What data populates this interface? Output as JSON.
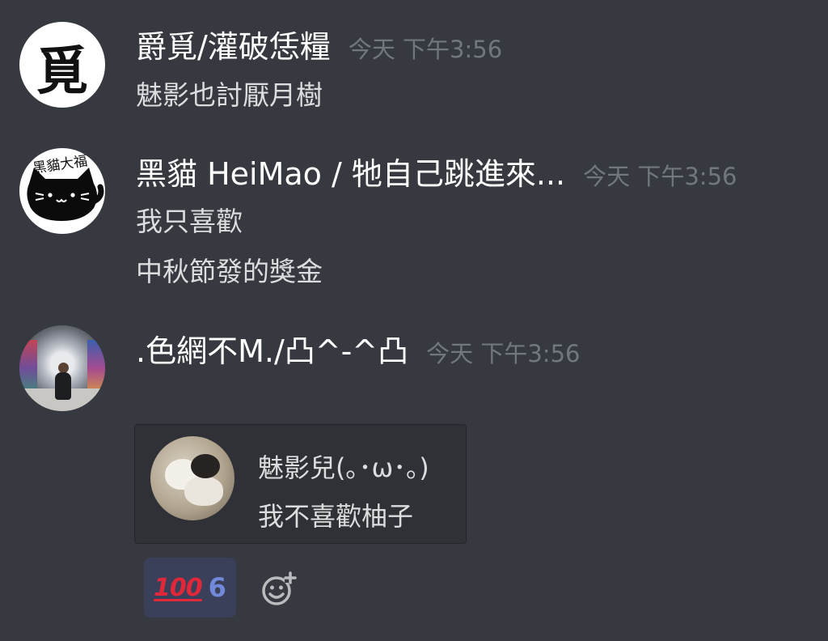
{
  "messages": [
    {
      "username": "爵覓/灌破恁糧",
      "timestamp": "今天 下午3:56",
      "avatar_glyph": "覓",
      "lines": [
        "魅影也討厭月樹"
      ]
    },
    {
      "username": "黑貓 HeiMao / 牠自己跳進來...",
      "timestamp": "今天 下午3:56",
      "avatar_text": "黑貓大福",
      "lines": [
        "我只喜歡",
        "中秋節發的獎金"
      ]
    },
    {
      "username": ".色網不M./凸^-^凸",
      "timestamp": "今天 下午3:56",
      "lines": []
    }
  ],
  "quote": {
    "name": "魅影兒(｡･ω･｡)",
    "text": "我不喜歡柚子"
  },
  "reaction": {
    "emoji": "100",
    "count": "6"
  },
  "icons": {
    "add_reaction": "add-reaction-icon"
  },
  "colors": {
    "background": "#36393f",
    "username": "#ffffff",
    "message": "#dcddde",
    "timestamp": "#72767d",
    "reaction_bg": "#3b405a",
    "reaction_count": "#7289da"
  }
}
